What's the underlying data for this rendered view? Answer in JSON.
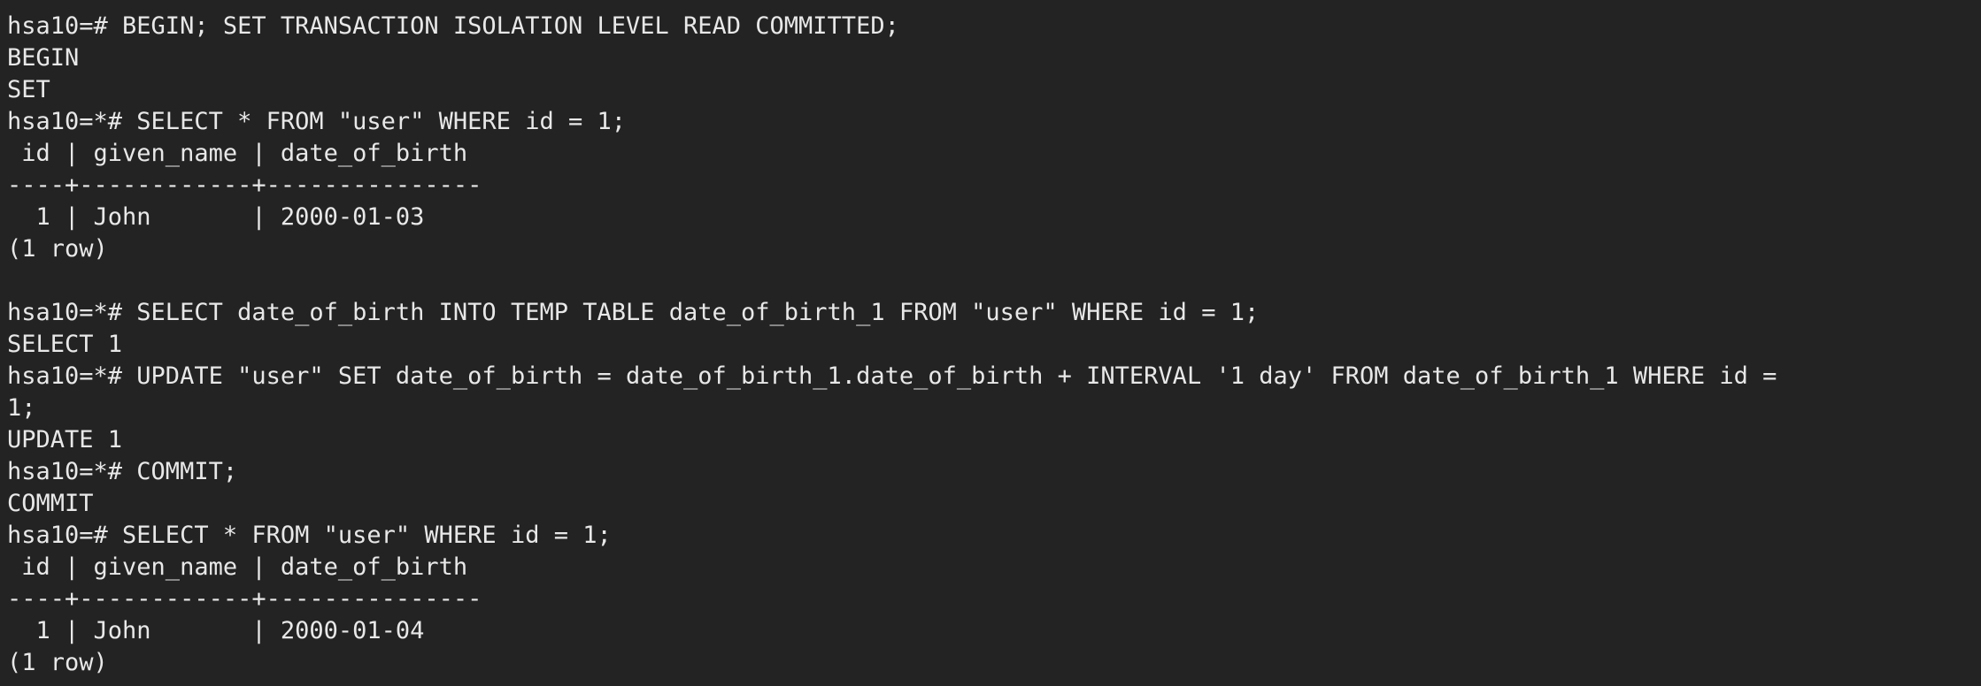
{
  "terminal": {
    "lines": [
      "hsa10=# BEGIN; SET TRANSACTION ISOLATION LEVEL READ COMMITTED;",
      "BEGIN",
      "SET",
      "hsa10=*# SELECT * FROM \"user\" WHERE id = 1;",
      " id | given_name | date_of_birth",
      "----+------------+---------------",
      "  1 | John       | 2000-01-03",
      "(1 row)",
      "",
      "hsa10=*# SELECT date_of_birth INTO TEMP TABLE date_of_birth_1 FROM \"user\" WHERE id = 1;",
      "SELECT 1",
      "hsa10=*# UPDATE \"user\" SET date_of_birth = date_of_birth_1.date_of_birth + INTERVAL '1 day' FROM date_of_birth_1 WHERE id =",
      "1;",
      "UPDATE 1",
      "hsa10=*# COMMIT;",
      "COMMIT",
      "hsa10=# SELECT * FROM \"user\" WHERE id = 1;",
      " id | given_name | date_of_birth",
      "----+------------+---------------",
      "  1 | John       | 2000-01-04",
      "(1 row)"
    ]
  }
}
